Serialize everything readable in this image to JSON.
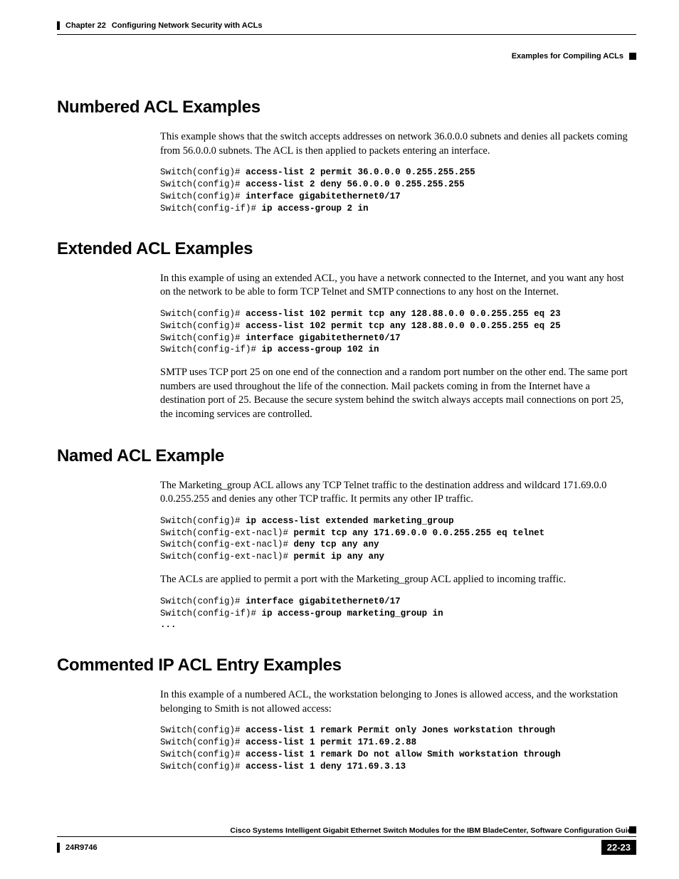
{
  "header": {
    "chapter": "Chapter 22",
    "title": "Configuring Network Security with ACLs",
    "right": "Examples for Compiling ACLs"
  },
  "sections": {
    "numbered": {
      "heading": "Numbered ACL Examples",
      "p1": "This example shows that the switch accepts addresses on network 36.0.0.0 subnets and denies all packets coming from 56.0.0.0 subnets. The ACL is then applied to packets entering an interface.",
      "code": [
        {
          "prompt": "Switch(config)# ",
          "cmd": "access-list 2 permit 36.0.0.0 0.255.255.255"
        },
        {
          "prompt": "Switch(config)# ",
          "cmd": "access-list 2 deny 56.0.0.0 0.255.255.255"
        },
        {
          "prompt": "Switch(config)# ",
          "cmd": "interface gigabitethernet0/17"
        },
        {
          "prompt": "Switch(config-if)# ",
          "cmd": "ip access-group 2 in"
        }
      ]
    },
    "extended": {
      "heading": "Extended ACL Examples",
      "p1": "In this example of using an extended ACL, you have a network connected to the Internet, and you want any host on the network to be able to form TCP Telnet and SMTP connections to any host on the Internet.",
      "code": [
        {
          "prompt": "Switch(config)# ",
          "cmd": "access-list 102 permit tcp any 128.88.0.0 0.0.255.255 eq 23"
        },
        {
          "prompt": "Switch(config)# ",
          "cmd": "access-list 102 permit tcp any 128.88.0.0 0.0.255.255 eq 25"
        },
        {
          "prompt": "Switch(config)# ",
          "cmd": "interface gigabitethernet0/17"
        },
        {
          "prompt": "Switch(config-if)# ",
          "cmd": "ip access-group 102 in"
        }
      ],
      "p2": "SMTP uses TCP port 25 on one end of the connection and a random port number on the other end. The same port numbers are used throughout the life of the connection. Mail packets coming in from the Internet have a destination port of 25. Because the secure system behind the switch always accepts mail connections on port 25, the incoming services are controlled."
    },
    "named": {
      "heading": "Named ACL Example",
      "p1": "The Marketing_group ACL allows any TCP Telnet traffic to the destination address and wildcard 171.69.0.0 0.0.255.255 and denies any other TCP traffic. It permits any other IP traffic.",
      "code1": [
        {
          "prompt": "Switch(config)# ",
          "cmd": "ip access-list extended marketing_group"
        },
        {
          "prompt": "Switch(config-ext-nacl)# ",
          "cmd": "permit tcp any 171.69.0.0 0.0.255.255 eq telnet"
        },
        {
          "prompt": "Switch(config-ext-nacl)# ",
          "cmd": "deny tcp any any"
        },
        {
          "prompt": "Switch(config-ext-nacl)# ",
          "cmd": "permit ip any any"
        }
      ],
      "p2": "The ACLs are applied to permit a port with the Marketing_group ACL applied to incoming traffic.",
      "code2": [
        {
          "prompt": "Switch(config)# ",
          "cmd": "interface gigabitethernet0/17"
        },
        {
          "prompt": "Switch(config-if)# ",
          "cmd": "ip access-group marketing_group in"
        },
        {
          "prompt": "",
          "cmd": "..."
        }
      ]
    },
    "commented": {
      "heading": "Commented IP ACL Entry Examples",
      "p1": "In this example of a numbered ACL, the workstation belonging to Jones is allowed access, and the workstation belonging to Smith is not allowed access:",
      "code": [
        {
          "prompt": "Switch(config)# ",
          "cmd": "access-list 1 remark Permit only Jones workstation through"
        },
        {
          "prompt": "Switch(config)# ",
          "cmd": "access-list 1 permit 171.69.2.88"
        },
        {
          "prompt": "Switch(config)# ",
          "cmd": "access-list 1 remark Do not allow Smith workstation through"
        },
        {
          "prompt": "Switch(config)# ",
          "cmd": "access-list 1 deny 171.69.3.13"
        }
      ]
    }
  },
  "footer": {
    "guide": "Cisco Systems Intelligent Gigabit Ethernet Switch Modules for the IBM BladeCenter, Software Configuration Guide",
    "docnum": "24R9746",
    "page": "22-23"
  }
}
